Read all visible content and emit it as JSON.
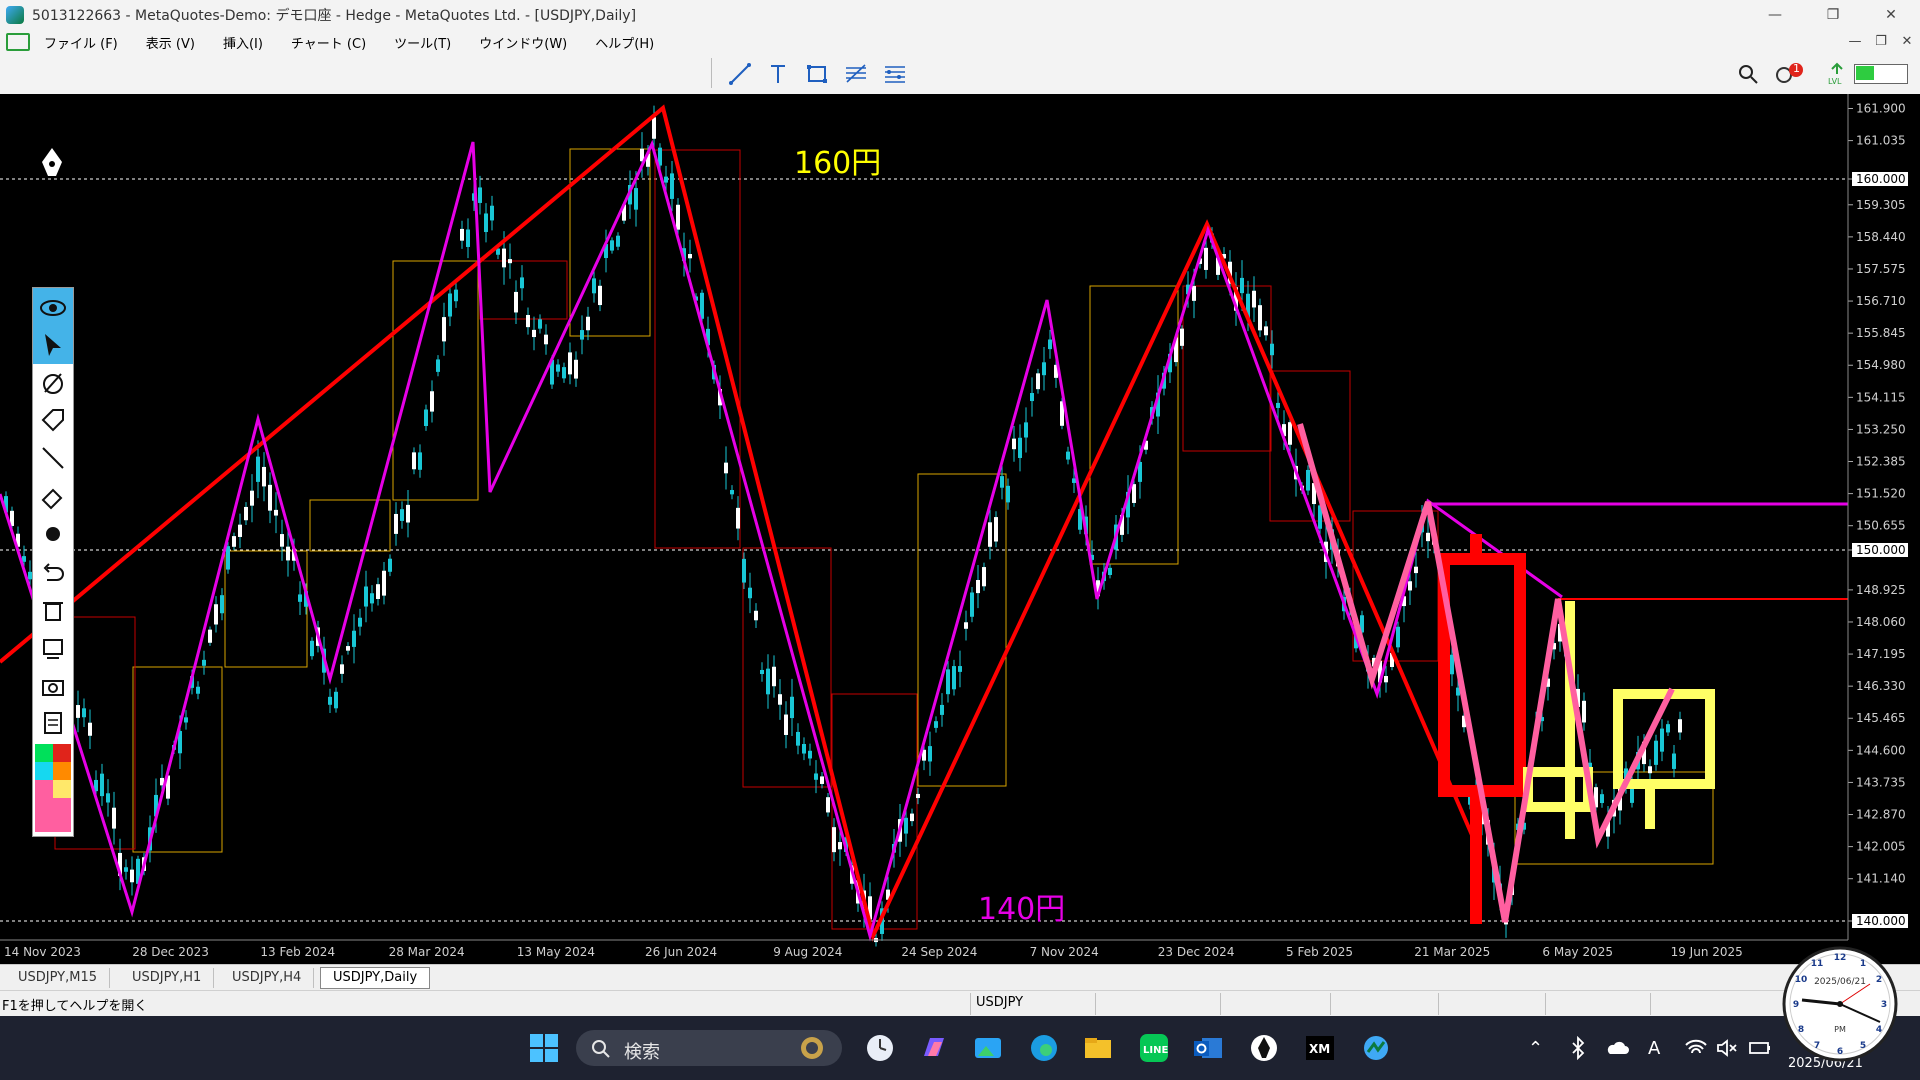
{
  "window": {
    "title": "5013122663 - MetaQuotes-Demo: デモ口座 - Hedge - MetaQuotes Ltd. - [USDJPY,Daily]",
    "controls": [
      "—",
      "❐",
      "✕"
    ]
  },
  "menu": {
    "items": [
      "ファイル (F)",
      "表示 (V)",
      "挿入(I)",
      "チャート (C)",
      "ツール(T)",
      "ウインドウ(W)",
      "ヘルプ(H)"
    ],
    "mdi_controls": [
      "—",
      "❐",
      "✕"
    ]
  },
  "toolbar": {
    "tools": [
      "trendline-icon",
      "text-icon",
      "rectangle-icon",
      "fibonacci-icon",
      "channel-icon"
    ],
    "right": {
      "search": "search-icon",
      "notifications_badge": "1",
      "battery_level": 0.35
    }
  },
  "chart": {
    "symbol": "USDJPY",
    "timeframe": "Daily",
    "annotations": {
      "upper": "160円",
      "lower": "140円"
    },
    "price_ticks": [
      "161.900",
      "161.035",
      "160.000",
      "159.305",
      "158.440",
      "157.575",
      "156.710",
      "155.845",
      "154.980",
      "154.115",
      "153.250",
      "152.385",
      "151.520",
      "150.655",
      "150.000",
      "148.925",
      "148.060",
      "147.195",
      "146.330",
      "145.465",
      "144.600",
      "143.735",
      "142.870",
      "142.005",
      "141.140",
      "140.000"
    ],
    "highlighted_prices": [
      "160.000",
      "150.000",
      "140.000"
    ],
    "date_ticks": [
      "14 Nov 2023",
      "28 Dec 2023",
      "13 Feb 2024",
      "28 Mar 2024",
      "13 May 2024",
      "26 Jun 2024",
      "9 Aug 2024",
      "24 Sep 2024",
      "7 Nov 2024",
      "23 Dec 2024",
      "5 Feb 2025",
      "21 Mar 2025",
      "6 May 2025",
      "19 Jun 2025"
    ],
    "colors": {
      "background": "#000000",
      "candle": "#19c7d6",
      "zigzag_major": "#ff0000",
      "zigzag_minor": "#e600e6",
      "box_yellow": "#d9a400",
      "box_red": "#c40000",
      "label_160": "#ffff00",
      "label_140": "#e600e6",
      "pink": "#ff5fa0",
      "bright_yellow": "#ffff66"
    }
  },
  "tabs": [
    "USDJPY,M15",
    "USDJPY,H1",
    "USDJPY,H4",
    "USDJPY,Daily"
  ],
  "active_tab": "USDJPY,Daily",
  "status": {
    "hint": "F1を押してヘルプを開く",
    "symbol": "USDJPY"
  },
  "taskbar": {
    "search_label": "検索",
    "clock_date": "2025/06/21",
    "clock_ampm": "PM",
    "date_partial": "2025/06/21"
  }
}
